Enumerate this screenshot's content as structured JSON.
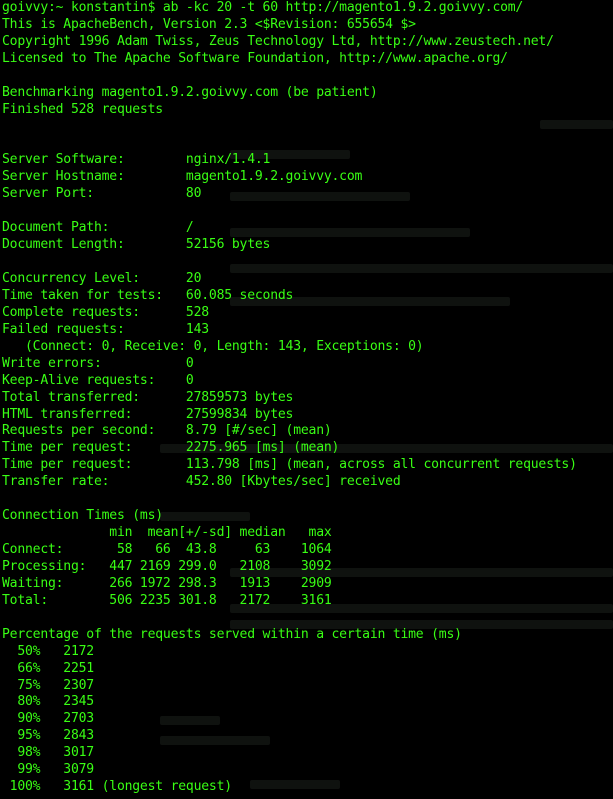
{
  "terminal": {
    "lines": [
      "goivvy:~ konstantin$ ab -kc 20 -t 60 http://magento1.9.2.goivvy.com/",
      "This is ApacheBench, Version 2.3 <$Revision: 655654 $>",
      "Copyright 1996 Adam Twiss, Zeus Technology Ltd, http://www.zeustech.net/",
      "Licensed to The Apache Software Foundation, http://www.apache.org/",
      "",
      "Benchmarking magento1.9.2.goivvy.com (be patient)",
      "Finished 528 requests",
      "",
      "",
      "Server Software:        nginx/1.4.1",
      "Server Hostname:        magento1.9.2.goivvy.com",
      "Server Port:            80",
      "",
      "Document Path:          /",
      "Document Length:        52156 bytes",
      "",
      "Concurrency Level:      20",
      "Time taken for tests:   60.085 seconds",
      "Complete requests:      528",
      "Failed requests:        143",
      "   (Connect: 0, Receive: 0, Length: 143, Exceptions: 0)",
      "Write errors:           0",
      "Keep-Alive requests:    0",
      "Total transferred:      27859573 bytes",
      "HTML transferred:       27599834 bytes",
      "Requests per second:    8.79 [#/sec] (mean)",
      "Time per request:       2275.965 [ms] (mean)",
      "Time per request:       113.798 [ms] (mean, across all concurrent requests)",
      "Transfer rate:          452.80 [Kbytes/sec] received",
      "",
      "Connection Times (ms)",
      "              min  mean[+/-sd] median   max",
      "Connect:       58   66  43.8     63    1064",
      "Processing:   447 2169 299.0   2108    3092",
      "Waiting:      266 1972 298.3   1913    2909",
      "Total:        506 2235 301.8   2172    3161",
      "",
      "Percentage of the requests served within a certain time (ms)",
      "  50%   2172",
      "  66%   2251",
      "  75%   2307",
      "  80%   2345",
      "  90%   2703",
      "  95%   2843",
      "  98%   3017",
      "  99%   3079",
      " 100%   3161 (longest request)"
    ]
  },
  "colors": {
    "background": "#000000",
    "text": "#39ff14"
  }
}
